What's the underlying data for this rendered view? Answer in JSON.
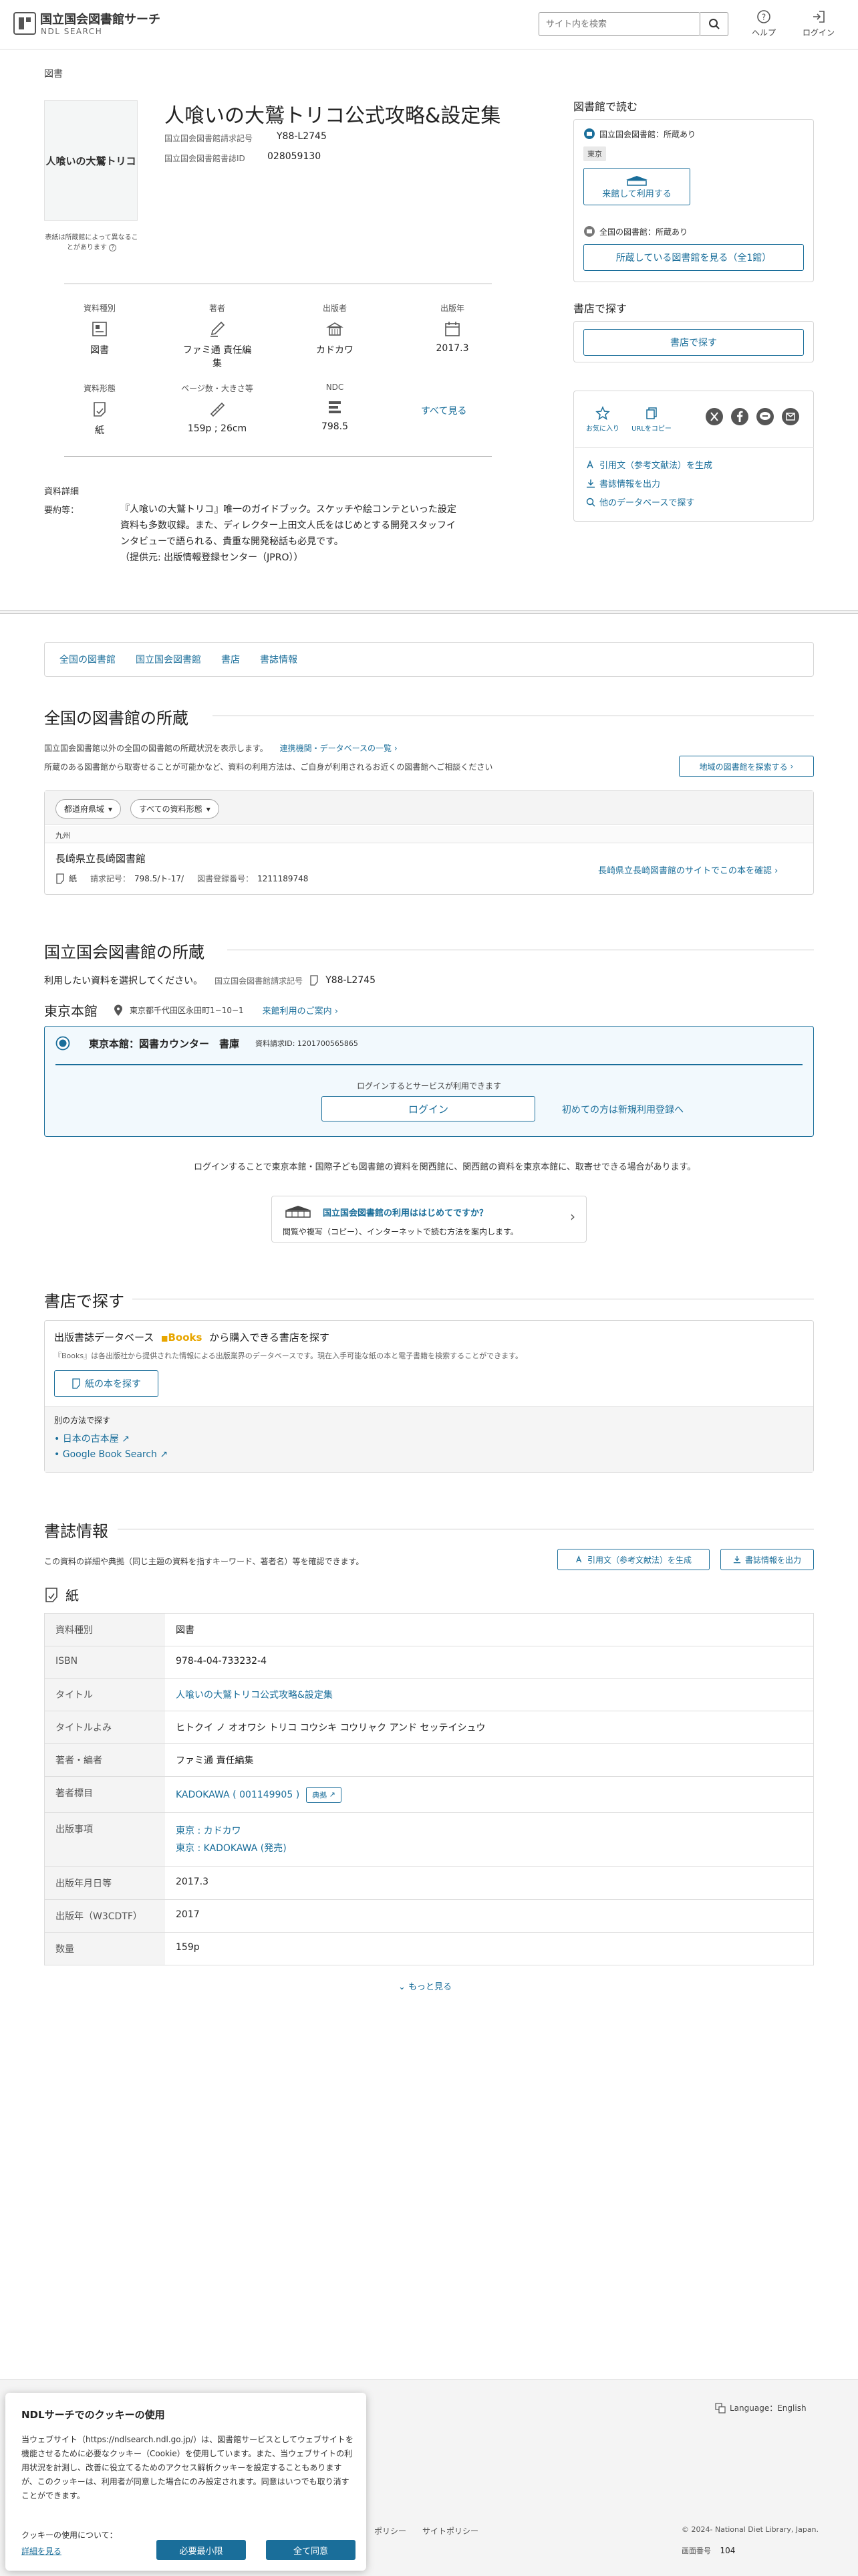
{
  "header": {
    "site_title": "国立国会図書館サーチ",
    "site_subtitle": "NDL SEARCH",
    "search_placeholder": "サイト内を検索",
    "help_label": "ヘルプ",
    "login_label": "ログイン"
  },
  "item": {
    "category": "図書",
    "title": "人喰いの大鷲トリコ公式攻略&設定集",
    "call_no_label": "国立国会図書館請求記号",
    "call_no": "Y88-L2745",
    "book_id_label": "国立国会図書館書誌ID",
    "book_id": "028059130",
    "cover_text": "人喰いの大鷲トリコ",
    "cover_caption": "表紙は所蔵館によって異なることがあります"
  },
  "attributes": [
    {
      "label": "資料種別",
      "value": "図書",
      "icon": "book-type-icon"
    },
    {
      "label": "著者",
      "value": "ファミ通 責任編集",
      "icon": "pen-icon"
    },
    {
      "label": "出版者",
      "value": "カドカワ",
      "icon": "building-icon"
    },
    {
      "label": "出版年",
      "value": "2017.3",
      "icon": "calendar-icon"
    },
    {
      "label": "資料形態",
      "value": "紙",
      "icon": "paper-icon"
    },
    {
      "label": "ページ数・大きさ等",
      "value": "159p ; 26cm",
      "icon": "ruler-icon"
    },
    {
      "label": "NDC",
      "value": "798.5",
      "icon": "ndc-icon"
    }
  ],
  "see_all_label": "すべて見る",
  "details": {
    "heading": "資料詳細",
    "summary_label": "要約等：",
    "summary_lines": [
      "『人喰いの大鷲トリコ』唯一のガイドブック。スケッチや絵コンテといった設定",
      "資料も多数収録。また、ディレクター上田文人氏をはじめとする開発スタッフイ",
      "ンタビューで語られる、貴重な開発秘話も必見です。",
      "（提供元: 出版情報登録センター（JPRO））"
    ]
  },
  "sidebar": {
    "read_heading": "図書館で読む",
    "ndl_holding": "国立国会図書館：所蔵あり",
    "tokyo_tag": "東京",
    "visit_btn": "来館して利用する",
    "all_holding": "全国の図書館：所蔵あり",
    "all_libs_btn": "所蔵している図書館を見る（全1館）",
    "store_heading": "書店で探す",
    "store_btn": "書店で探す",
    "fav_label": "お気に入り",
    "copy_url_label": "URLをコピー",
    "cite_link": "引用文（参考文献法）を生成",
    "export_link": "書誌情報を出力",
    "other_db_link": "他のデータベースで探す"
  },
  "tabs": [
    "全国の図書館",
    "国立国会図書館",
    "書店",
    "書誌情報"
  ],
  "national": {
    "heading": "全国の図書館の所蔵",
    "desc1": "国立国会図書館以外の全国の図書館の所蔵状況を表示します。",
    "desc1_link": "連携機関・データベースの一覧",
    "desc2": "所蔵のある図書館から取寄せることが可能かなど、資料の利用方法は、ご自身が利用されるお近くの図書館へご相談ください",
    "nearby_btn": "地域の図書館を探索する",
    "filter_pref": "都道府県域",
    "filter_type": "すべての資料形態",
    "region": "九州",
    "library_name": "長崎県立長崎図書館",
    "format": "紙",
    "call_label": "請求記号：",
    "call_value": "798.5/ト-17/",
    "reg_label": "図書登録番号：",
    "reg_value": "1211189748",
    "lib_link": "長崎県立長崎図書館のサイトでこの本を確認"
  },
  "ndl": {
    "heading": "国立国会図書館の所蔵",
    "select_text": "利用したい資料を選択してください。",
    "call_label": "国立国会図書館請求記号",
    "call_value": "Y88-L2745",
    "branch": "東京本館",
    "address": "東京都千代田区永田町1−10−1",
    "guide_link": "来館利用のご案内",
    "option_label": "東京本館：図書カウンター　書庫",
    "item_id": "資料請求ID: 1201700565865",
    "login_note": "ログインするとサービスが利用できます",
    "login_btn": "ログイン",
    "register_link": "初めての方は新規利用登録へ",
    "login_info": "ログインすることで東京本館・国際子ども図書館の資料を関西館に、関西館の資料を東京本館に、取寄せできる場合があります。",
    "banner_title": "国立国会図書館の利用ははじめてですか？",
    "banner_text": "閲覧や複写（コピー）、インターネットで読む方法を案内します。"
  },
  "store": {
    "heading": "書店で探す",
    "db_prefix": "出版書誌データベース",
    "db_brand": "Books",
    "db_suffix": "から購入できる書店を探す",
    "note": "『Books』は各出版社から提供された情報による出版業界のデータベースです。現在入手可能な紙の本と電子書籍を検索することができます。",
    "paper_btn": "紙の本を探す",
    "alt_heading": "別の方法で探す",
    "alt_links": [
      "日本の古本屋",
      "Google Book Search"
    ]
  },
  "biblio": {
    "heading": "書誌情報",
    "desc": "この資料の詳細や典拠（同じ主題の資料を指すキーワード、著者名）等を確認できます。",
    "cite_btn": "引用文（参考文献法）を生成",
    "export_btn": "書誌情報を出力",
    "format_label": "紙",
    "rows": [
      {
        "label": "資料種別",
        "value": "図書"
      },
      {
        "label": "ISBN",
        "value": "978-4-04-733232-4"
      },
      {
        "label": "タイトル",
        "value": "人喰いの大鷲トリコ公式攻略&設定集"
      },
      {
        "label": "タイトルよみ",
        "value": "ヒトクイ ノ オオワシ トリコ コウシキ コウリャク アンド セッテイシュウ"
      },
      {
        "label": "著者・編者",
        "value": "ファミ通 責任編集"
      },
      {
        "label": "著者標目",
        "value": "KADOKAWA ( 001149905 )",
        "extra": "典拠"
      },
      {
        "label": "出版事項",
        "value": "東京 : カドカワ",
        "value2": "東京 : KADOKAWA (発売)"
      },
      {
        "label": "出版年月日等",
        "value": "2017.3"
      },
      {
        "label": "出版年（W3CDTF）",
        "value": "2017"
      },
      {
        "label": "数量",
        "value": "159p"
      }
    ],
    "more": "もっと見る"
  },
  "footer": {
    "language": "Language：English",
    "links_partial": "ポリシー　　サイトポリシー",
    "copyright": "© 2024- National Diet Library, Japan.",
    "screen_no_label": "画面番号",
    "screen_no": "104"
  },
  "cookie": {
    "title": "NDLサーチでのクッキーの使用",
    "body": "当ウェブサイト（https://ndlsearch.ndl.go.jp/）は、図書館サービスとしてウェブサイトを機能させるために必要なクッキー（Cookie）を使用しています。また、当ウェブサイトの利用状況を計測し、改善に役立てるためのアクセス解析クッキーを設定することもありますが、このクッキーは、利用者が同意した場合にのみ設定されます。同意はいつでも取り消すことができます。",
    "usage_label": "クッキーの使用について：",
    "details_link": "詳細を見る",
    "necessary_btn": "必要最小限",
    "accept_btn": "全て同意"
  },
  "colors": {
    "accent": "#1a6e9a",
    "border": "#d5d5d5",
    "panel_bg": "#f2f9fd"
  }
}
